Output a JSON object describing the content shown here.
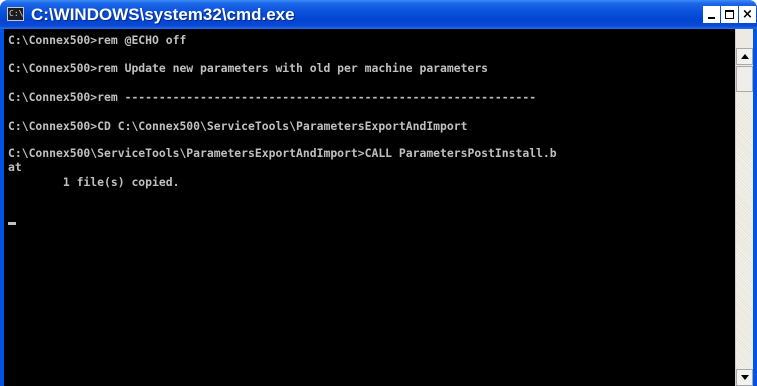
{
  "window": {
    "title": "C:\\WINDOWS\\system32\\cmd.exe",
    "icon_text": "C:\\",
    "controls": {
      "minimize_label": "",
      "maximize_label": "",
      "close_label": "×"
    }
  },
  "console": {
    "lines": [
      "C:\\Connex500>rem @ECHO off",
      "",
      "C:\\Connex500>rem Update new parameters with old per machine parameters",
      "",
      "C:\\Connex500>rem ------------------------------------------------------------",
      "",
      "C:\\Connex500>CD C:\\Connex500\\ServiceTools\\ParametersExportAndImport",
      "",
      "C:\\Connex500\\ServiceTools\\ParametersExportAndImport>CALL ParametersPostInstall.b",
      "at",
      "        1 file(s) copied.",
      "",
      ""
    ],
    "cursor_line": 12
  },
  "scrollbar": {
    "up_icon": "arrow-up-icon",
    "down_icon": "arrow-down-icon"
  },
  "colors": {
    "titlebar": "#0a52dd",
    "console_bg": "#000000",
    "console_text": "#c0c0c0"
  }
}
